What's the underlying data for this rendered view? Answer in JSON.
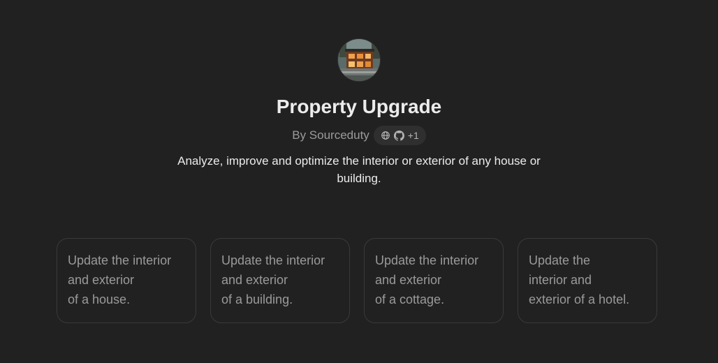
{
  "gpt": {
    "title": "Property Upgrade",
    "author": "By Sourceduty",
    "badge_extra": "+1",
    "description": "Analyze, improve and optimize the interior or exterior of any house or building."
  },
  "icons": {
    "avatar": "modern-building-photo",
    "website": "globe-icon",
    "github": "github-icon"
  },
  "starters": [
    {
      "lines": [
        "Update the interior",
        "and exterior",
        "of a house."
      ]
    },
    {
      "lines": [
        "Update the interior",
        "and exterior",
        "of a building."
      ]
    },
    {
      "lines": [
        "Update the interior",
        "and exterior",
        "of a cottage."
      ]
    },
    {
      "lines": [
        "Update the",
        "interior and",
        "exterior of a hotel."
      ]
    }
  ],
  "colors": {
    "background": "#212121",
    "card_border": "#3a3a3a",
    "badge_background": "#2f2f2f"
  }
}
